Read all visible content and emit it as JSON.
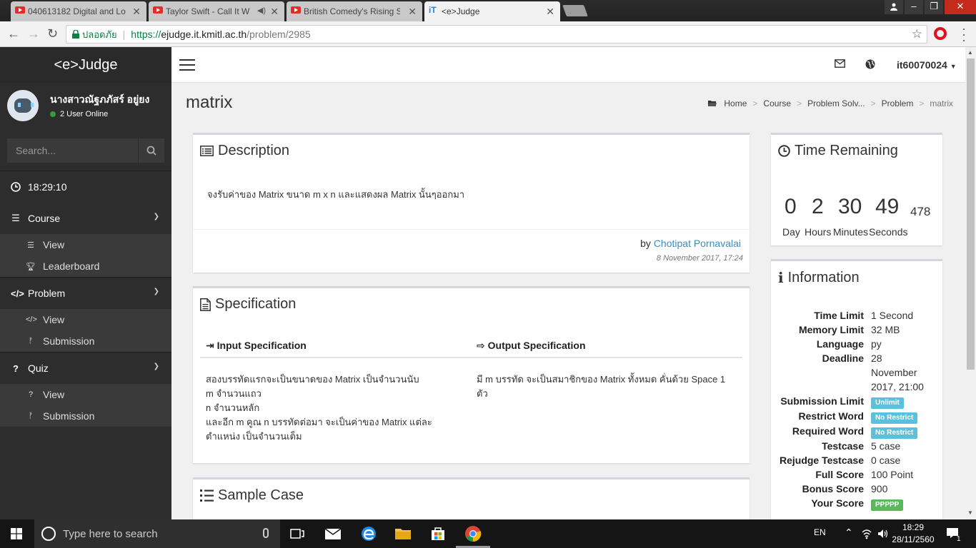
{
  "browser": {
    "tabs": [
      {
        "title": "040613182 Digital and Lo",
        "icon": "youtube-icon"
      },
      {
        "title": "Taylor Swift - Call It W",
        "icon": "youtube-icon"
      },
      {
        "title": "British Comedy's Rising S",
        "icon": "youtube-icon"
      },
      {
        "title": "<e>Judge",
        "icon": "site-icon"
      }
    ],
    "secure_label": "ปลอดภัย",
    "url_protocol": "https://",
    "url_host": "ejudge.it.kmitl.ac.th",
    "url_path": "/problem/2985"
  },
  "sidebar": {
    "brand": "<e>Judge",
    "user_name": "นางสาวณัฐภภัสร์ อยู่ยง",
    "online": "2 User Online",
    "search_placeholder": "Search...",
    "clock": "18:29:10",
    "menus": [
      {
        "label": "Course",
        "icon": "list-icon",
        "items": [
          {
            "label": "View",
            "icon": "list-icon"
          },
          {
            "label": "Leaderboard",
            "icon": "trophy-icon"
          }
        ]
      },
      {
        "label": "Problem",
        "icon": "code-icon",
        "items": [
          {
            "label": "View",
            "icon": "code-icon"
          },
          {
            "label": "Submission",
            "icon": "branch-icon"
          }
        ]
      },
      {
        "label": "Quiz",
        "icon": "question-icon",
        "items": [
          {
            "label": "View",
            "icon": "question-icon"
          },
          {
            "label": "Submission",
            "icon": "branch-icon"
          }
        ]
      }
    ]
  },
  "navbar": {
    "username": "it60070024"
  },
  "page": {
    "title": "matrix",
    "breadcrumb": [
      "Home",
      "Course",
      "Problem Solv...",
      "Problem",
      "matrix"
    ]
  },
  "description": {
    "heading": "Description",
    "text": "จงรับค่าของ Matrix ขนาด m x n และแสดงผล Matrix นั้นๆออกมา",
    "by_label": "by",
    "author": "Chotipat Pornavalai",
    "posted": "8 November 2017, 17:24"
  },
  "specification": {
    "heading": "Specification",
    "input_heading": "Input Specification",
    "input_text": "สองบรรทัดแรกจะเป็นขนาดของ Matrix เป็นจำนวนนับ\nm จำนวนแถว\nn จำนวนหลัก\nและอีก m คูณ n บรรทัดต่อมา จะเป็นค่าของ Matrix แต่ละ\nตำแหน่ง เป็นจำนวนเต็ม",
    "output_heading": "Output Specification",
    "output_text": "มี m บรรทัด จะเป็นสมาชิกของ Matrix ทั้งหมด คั่นด้วย Space 1\nตัว"
  },
  "sample": {
    "heading": "Sample Case"
  },
  "timer": {
    "heading": "Time Remaining",
    "days": "0",
    "hours": "2",
    "minutes": "30",
    "seconds": "49",
    "millis": "478",
    "day_label": "Day",
    "hours_label": "Hours",
    "minutes_label": "Minutes",
    "seconds_label": "Seconds"
  },
  "info": {
    "heading": "Information",
    "rows": [
      {
        "key": "Time Limit",
        "value": "1 Second"
      },
      {
        "key": "Memory Limit",
        "value": "32 MB"
      },
      {
        "key": "Language",
        "value": "py"
      },
      {
        "key": "Deadline",
        "value": "28 November 2017, 21:00"
      },
      {
        "key": "Submission Limit",
        "value": "Unlimit",
        "badge": "blue"
      },
      {
        "key": "Restrict Word",
        "value": "No Restrict",
        "badge": "blue"
      },
      {
        "key": "Required Word",
        "value": "No Restrict",
        "badge": "blue"
      },
      {
        "key": "Testcase",
        "value": "5 case"
      },
      {
        "key": "Rejudge Testcase",
        "value": "0 case"
      },
      {
        "key": "Full Score",
        "value": "100 Point"
      },
      {
        "key": "Bonus Score",
        "value": "900"
      },
      {
        "key": "Your Score",
        "value": "PPPPP",
        "badge": "green"
      }
    ]
  },
  "taskbar": {
    "search_placeholder": "Type here to search",
    "language": "EN",
    "time": "18:29",
    "date": "28/11/2560",
    "notifications": "1"
  },
  "colors": {
    "link": "#3c8dbc",
    "badge_blue": "#5bc0de",
    "badge_green": "#5cb85c",
    "sidebar_bg": "#2d2d2d"
  }
}
